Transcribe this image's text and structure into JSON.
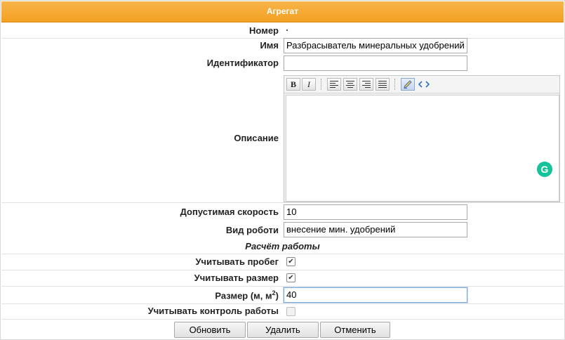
{
  "form": {
    "title": "Агрегат",
    "number_label": "Номер",
    "number_value": ".",
    "name_label": "Имя",
    "name_value": "Разбрасыватель минеральных удобрений",
    "identifier_label": "Идентификатор",
    "identifier_value": "",
    "description_label": "Описание",
    "description_toolbar": {
      "bold": "B",
      "italic": "I",
      "align_left": "align-left-icon",
      "align_center": "align-center-icon",
      "align_right": "align-right-icon",
      "align_justify": "align-justify-icon",
      "wysiwyg_mode": "pencil-icon",
      "source_mode": "code-icon"
    },
    "description_value": "",
    "grammarly_badge": "G",
    "speed_label": "Допустимая скорость",
    "speed_value": "10",
    "work_type_label": "Вид роботи",
    "work_type_value": "внесение мин. удобрений",
    "section_title": "Расчёт работы",
    "mileage_label": "Учитывать пробег",
    "mileage_checked": true,
    "size_check_label": "Учитывать размер",
    "size_check_checked": true,
    "size_label_prefix": "Размер (м, м",
    "size_label_sup": "2",
    "size_label_suffix": ")",
    "size_value": "40",
    "control_label": "Учитывать контроль работы",
    "control_checked": false
  },
  "buttons": {
    "update": "Обновить",
    "delete": "Удалить",
    "cancel": "Отменить"
  },
  "colors": {
    "title_bar": "#f3a021",
    "grammarly": "#15c39a"
  }
}
